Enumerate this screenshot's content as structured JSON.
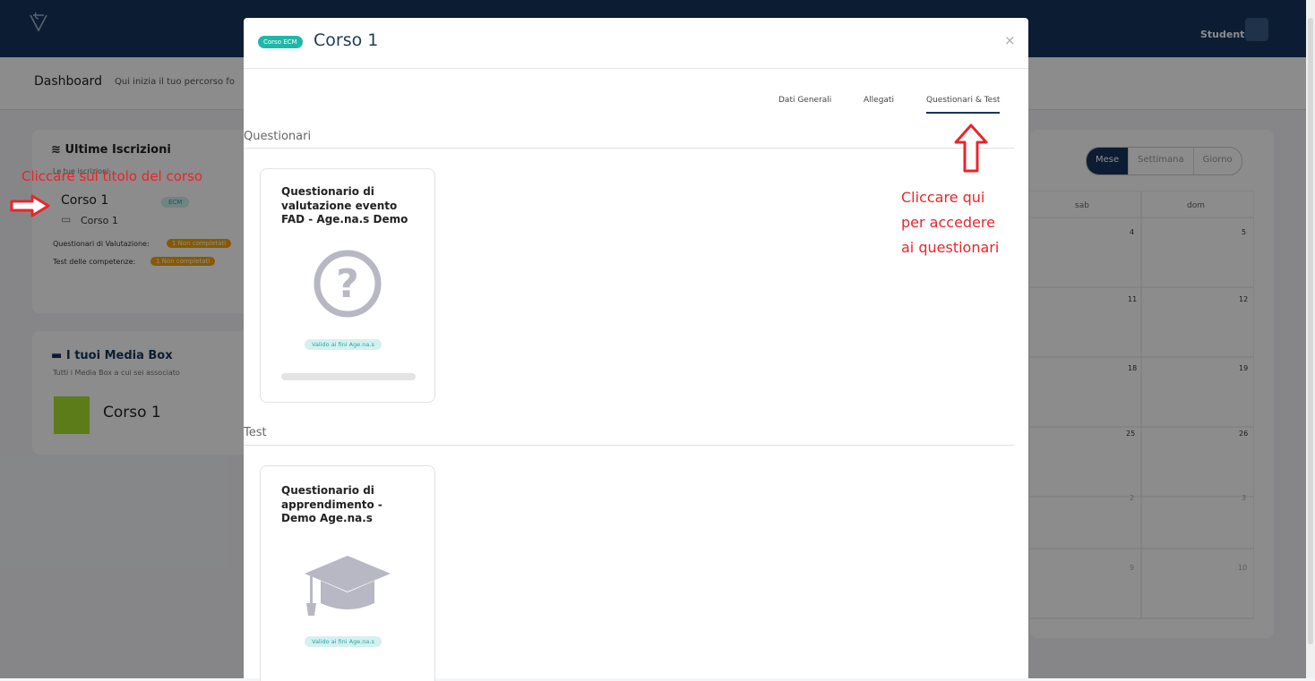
{
  "topbar": {
    "user_label": "Studente"
  },
  "dashboard": {
    "title": "Dashboard",
    "subtitle": "Qui inizia il tuo percorso fo"
  },
  "iscrizioni": {
    "title": "Ultime Iscrizioni",
    "subtitle": "Le tue iscrizioni",
    "course_title": "Corso 1",
    "course_badge": "ECM",
    "sub_course": "Corso 1",
    "questionari_label": "Questionari di Valutazione:",
    "questionari_status": "1 Non completati",
    "test_label": "Test delle competenze:",
    "test_status": "1 Non completati"
  },
  "mediabox": {
    "title": "I tuoi Media Box",
    "subtitle": "Tutti i Media Box a cui sei associato",
    "item": "Corso 1"
  },
  "calendar": {
    "views": [
      "Mese",
      "Settimana",
      "Giorno"
    ],
    "active_view": "Mese",
    "days": [
      "sab",
      "dom"
    ],
    "weeks": [
      [
        "4",
        "5"
      ],
      [
        "11",
        "12"
      ],
      [
        "18",
        "19"
      ],
      [
        "25",
        "26"
      ],
      [
        "2",
        "3"
      ],
      [
        "9",
        "10"
      ]
    ]
  },
  "modal": {
    "badge": "Corso ECM",
    "title": "Corso 1",
    "close": "×",
    "tabs": [
      "Dati Generali",
      "Allegati",
      "Questionari & Test"
    ],
    "active_tab": "Questionari & Test",
    "section_questionari": "Questionari",
    "section_test": "Test",
    "questionari": [
      {
        "title": "Questionario di valutazione evento FAD - Age.na.s Demo",
        "badge": "Valido ai fini Age.na.s",
        "icon": "question-circle-icon"
      }
    ],
    "tests": [
      {
        "title": "Questionario di apprendimento - Demo Age.na.s",
        "badge": "Valido ai fini Age.na.s",
        "icon": "graduation-cap-icon"
      }
    ]
  },
  "annotations": {
    "left": "Cliccare sul titolo del corso",
    "right": [
      "Cliccare qui",
      "per accedere",
      "ai questionari"
    ]
  },
  "colors": {
    "navy": "#16365e",
    "teal": "#1fb8a8",
    "orange": "#f5a400",
    "red_annotation": "#e8252b",
    "lime": "#a6e22e"
  }
}
